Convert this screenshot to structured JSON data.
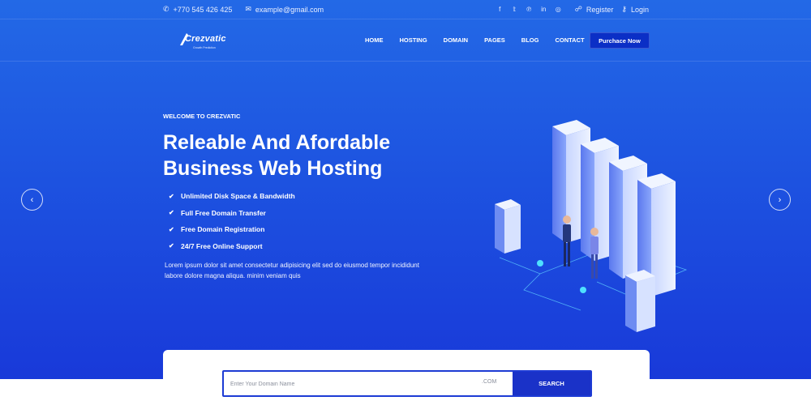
{
  "topbar": {
    "phone": "+770 545 426 425",
    "email": "example@gmail.com",
    "social_icons": [
      "facebook-icon",
      "twitter-icon",
      "pinterest-icon",
      "linkedin-icon",
      "dribbble-icon"
    ],
    "register": "Register",
    "login": "Login"
  },
  "brand": {
    "name": "Crezvatic",
    "tagline": "Growth Prediction"
  },
  "nav": {
    "items": [
      "HOME",
      "HOSTING",
      "DOMAIN",
      "PAGES",
      "BLOG",
      "CONTACT"
    ],
    "cta": "Purchace Now"
  },
  "hero": {
    "welcome": "WELCOME TO CREZVATIC",
    "title_line1": "Releable And Afordable",
    "title_line2": "Business Web Hosting",
    "features": [
      "Unlimited Disk Space & Bandwidth",
      "Full Free Domain Transfer",
      "Free Domain Registration",
      "24/7 Free Online Support"
    ],
    "description": "Lorem ipsum dolor sit amet consectetur adipisicing elit sed do eiusmod tempor incididunt labore dolore magna aliqua. minim veniam quis"
  },
  "search": {
    "placeholder": "Enter Your Domain Name",
    "tld": ".COM",
    "button": "SEARCH"
  },
  "colors": {
    "hero_top": "#2369e6",
    "hero_bottom": "#1836d8",
    "button": "#0b2fc6",
    "accent": "#1d3bd4"
  }
}
